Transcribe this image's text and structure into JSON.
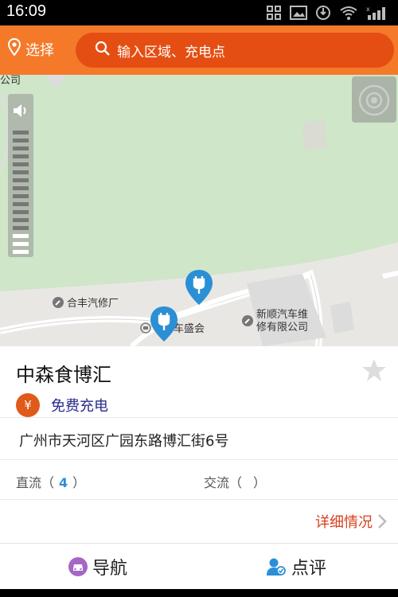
{
  "status_bar": {
    "time": "16:09",
    "icons": [
      "app-icon",
      "image-icon",
      "sync-icon",
      "wifi-icon",
      "signal-icon"
    ]
  },
  "header": {
    "select_label": "选择",
    "search_placeholder": "输入区域、充电点"
  },
  "map": {
    "labels": [
      "公司",
      "合丰汽修厂",
      "车盛会",
      "新顺汽车维",
      "修有限公司"
    ],
    "pin_count": 2
  },
  "station": {
    "name": "中森食博汇",
    "fee_icon": "¥",
    "fee_text": "免费充电",
    "address": "广州市天河区广园东路博汇街6号",
    "dc_label": "直流（",
    "dc_count": "4",
    "dc_close": "）",
    "ac_label": "交流（",
    "ac_count": "",
    "ac_close": "）",
    "detail_label": "详细情况"
  },
  "bottom_bar": {
    "navigate_label": "导航",
    "review_label": "点评"
  },
  "colors": {
    "header_orange": "#f47a2a",
    "search_bg": "#e54e12",
    "pin_blue": "#2b8fd6",
    "detail_red": "#d8401c"
  }
}
